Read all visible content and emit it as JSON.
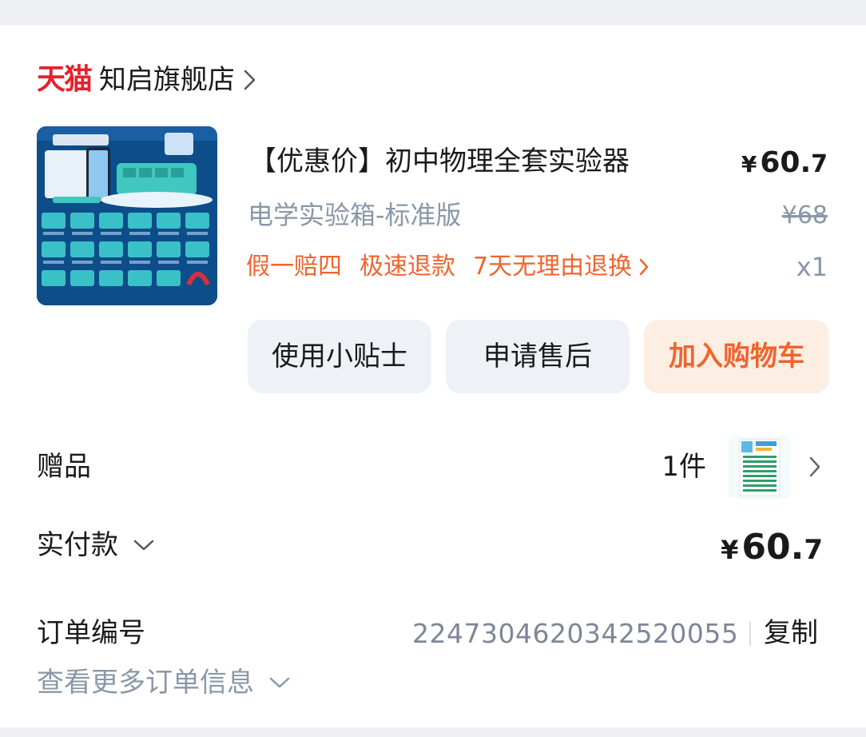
{
  "shop": {
    "platform_logo": "天猫",
    "name": "知启旗舰店",
    "chevron_icon": "chevron-right-icon"
  },
  "product": {
    "image_icon": "product-thumbnail",
    "title": "【优惠价】初中物理全套实验器",
    "price_currency": "¥",
    "price_integer": "60.",
    "price_decimal": "7",
    "variant": "电学实验箱-标准版",
    "original_price": "¥68",
    "services": [
      "假一赔四",
      "极速退款",
      "7天无理由退换"
    ],
    "quantity": "x1",
    "accent_color": "#f0642c"
  },
  "actions": {
    "tips_label": "使用小贴士",
    "after_sale_label": "申请售后",
    "add_cart_label": "加入购物车"
  },
  "gift": {
    "label": "赠品",
    "count": "1件"
  },
  "payment": {
    "label": "实付款",
    "currency": "¥",
    "amount_integer": "60.",
    "amount_decimal": "7"
  },
  "order": {
    "label": "订单编号",
    "number": "2247304620342520055",
    "copy_label": "复制",
    "more_label": "查看更多订单信息"
  }
}
